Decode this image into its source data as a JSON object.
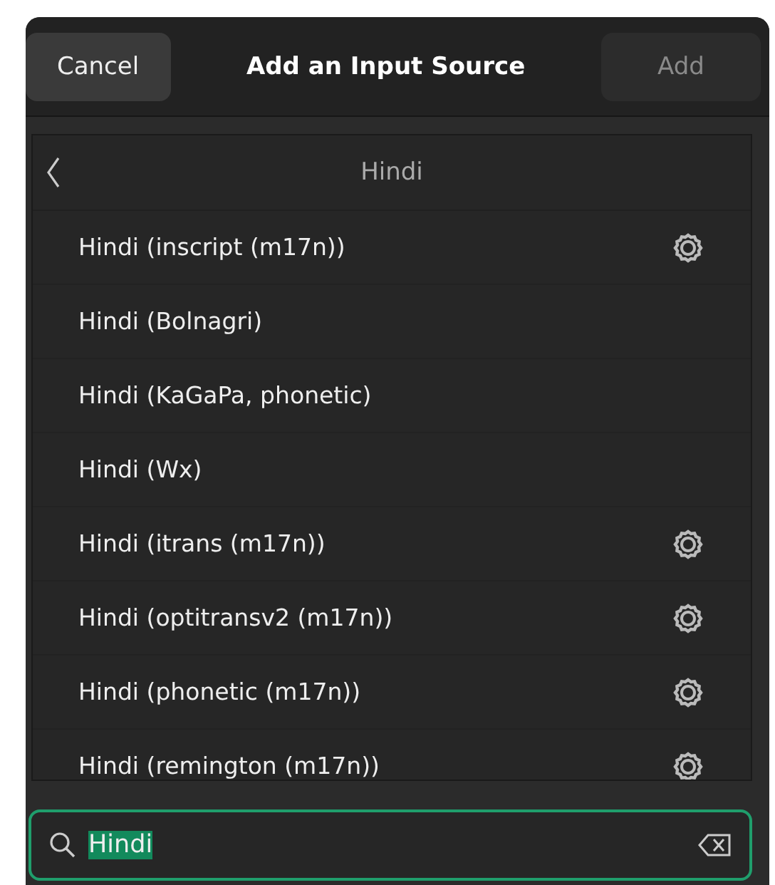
{
  "header": {
    "cancel_button": "Cancel",
    "title": "Add an Input Source",
    "add_button": {
      "label": "Add",
      "disabled": true
    }
  },
  "list": {
    "back_title": "Hindi",
    "items": [
      {
        "label": "Hindi (inscript (m17n))",
        "has_settings": true
      },
      {
        "label": "Hindi (Bolnagri)",
        "has_settings": false
      },
      {
        "label": "Hindi (KaGaPa, phonetic)",
        "has_settings": false
      },
      {
        "label": "Hindi (Wx)",
        "has_settings": false
      },
      {
        "label": "Hindi (itrans (m17n))",
        "has_settings": true
      },
      {
        "label": "Hindi (optitransv2 (m17n))",
        "has_settings": true
      },
      {
        "label": "Hindi (phonetic (m17n))",
        "has_settings": true
      },
      {
        "label": "Hindi (remington (m17n))",
        "has_settings": true
      }
    ]
  },
  "search": {
    "value": "Hindi",
    "value_selected": true
  }
}
